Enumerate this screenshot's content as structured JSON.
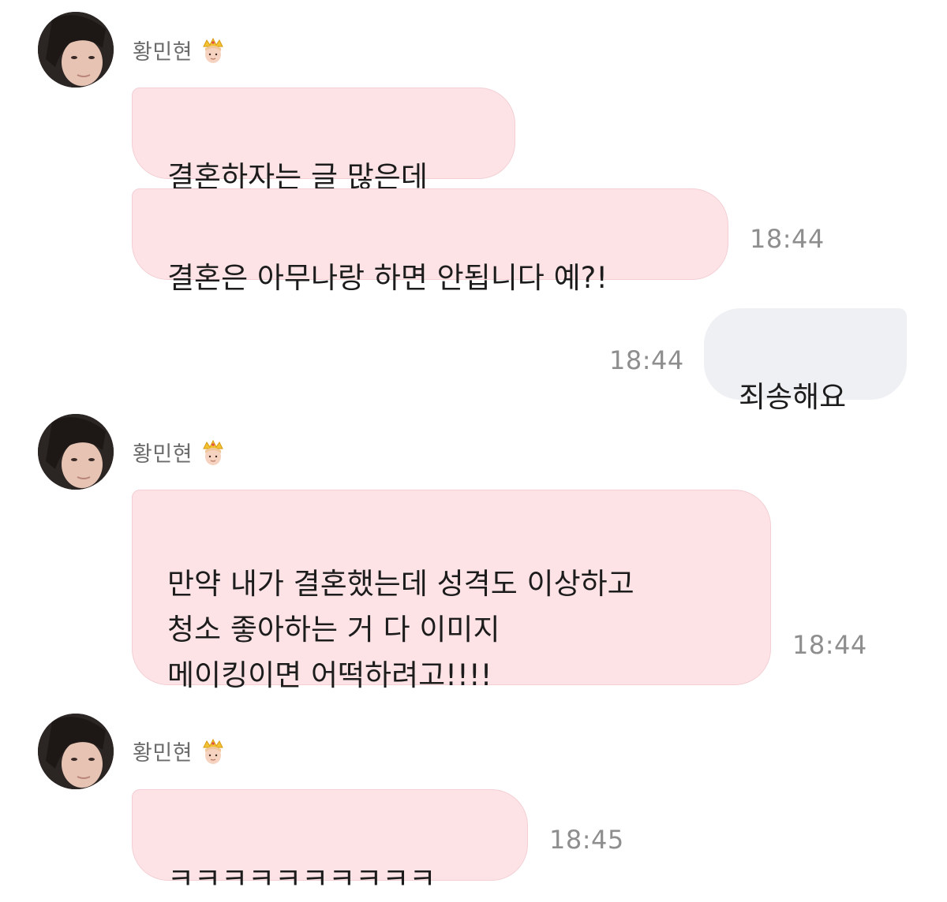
{
  "messages": [
    {
      "sender": "황민현",
      "texts": [
        "결혼하자는 글 많은데",
        "결혼은 아무나랑 하면 안됩니다 예?!"
      ],
      "time": "18:44"
    },
    {
      "reply": "죄송해요",
      "time": "18:44"
    },
    {
      "sender": "황민현",
      "texts": [
        "만약 내가 결혼했는데 성격도 이상하고\n청소 좋아하는 거 다 이미지\n메이킹이면 어떡하려고!!!!"
      ],
      "time": "18:44"
    },
    {
      "sender": "황민현",
      "texts": [
        "ㅋㅋㅋㅋㅋㅋㅋㅋㅋㅋ"
      ],
      "time": "18:45"
    }
  ],
  "icons": {
    "badge": "prince-crown-icon",
    "avatar": "profile-photo"
  },
  "colors": {
    "incoming_bubble": "#fde3e6",
    "outgoing_bubble": "#eff0f4",
    "timestamp": "#8e8e8e",
    "sender_name": "#6b6b6b"
  }
}
